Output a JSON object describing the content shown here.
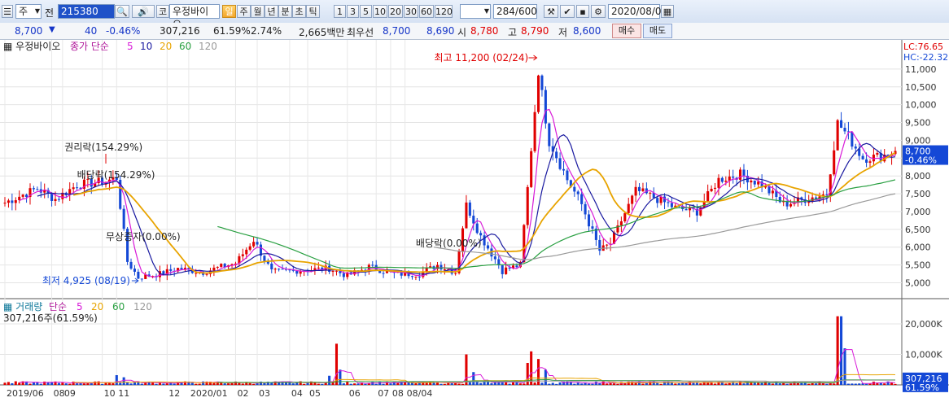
{
  "toolbar": {
    "market_options": [
      "주",
      "전"
    ],
    "stock_code": "215380",
    "stock_name": "우정바이오",
    "period_labels": [
      "주",
      "월",
      "년",
      "분",
      "초",
      "틱"
    ],
    "active_period_label": "일",
    "minute_intervals": [
      "1",
      "3",
      "5",
      "10",
      "20",
      "30",
      "60",
      "120"
    ],
    "data_count": "284",
    "data_max": "/600",
    "date": "2020/08/04",
    "code_prefix": "코"
  },
  "quote": {
    "price": "8,700",
    "change": "40",
    "change_pct": "-0.46%",
    "volume": "307,216",
    "volume_pct": "61.59%",
    "turnover": "2.74%",
    "amount": "2,665백만",
    "bid_label": "최우선",
    "bid_ask": "8,700",
    "bid": "8,690",
    "open_label": "시",
    "open": "8,780",
    "high_label": "고",
    "high": "8,790",
    "low_label": "저",
    "low": "8,600",
    "buy_label": "매수",
    "sell_label": "매도"
  },
  "price_panel": {
    "stock_label": "우정바이오",
    "legend_prefix": "종가 단순",
    "ma_periods": [
      "5",
      "10",
      "20",
      "60",
      "120"
    ],
    "ma_colors": [
      "#d81bd8",
      "#1a1aa0",
      "#e8a400",
      "#2aa042",
      "#9a9a9a"
    ],
    "lc_label": "LC:76.65",
    "hc_label": "HC:-22.32",
    "last_price_label": "8,700",
    "last_change_label": "-0.46%",
    "annotations": {
      "high": "최고 11,200 (02/24)",
      "low": "최저 4,925 (08/19)",
      "rights1": "권리락(154.29%)",
      "rights2": "배당락(154.29%)",
      "free_issue": "무상증자(0.00%)",
      "dividend": "배당락(0.00%)"
    }
  },
  "volume_panel": {
    "label": "거래량",
    "legend_prefix": "단순",
    "ma_periods": [
      "5",
      "20",
      "60",
      "120"
    ],
    "summary": "307,216주(61.59%)",
    "last_value_label": "307,216",
    "last_pct_label": "61.59%"
  },
  "chart_data": {
    "type": "candlestick",
    "price_axis": {
      "ylim": [
        4600,
        11500
      ],
      "ticks": [
        5000,
        5500,
        6000,
        6500,
        7000,
        7500,
        8000,
        8500,
        9000,
        9500,
        10000,
        10500,
        11000
      ],
      "tick_labels": [
        "5,000",
        "5,500",
        "6,000",
        "6,500",
        "7,000",
        "7,500",
        "8,000",
        "8,500",
        "9,000",
        "9,500",
        "10,000",
        "10,500",
        "11,000"
      ]
    },
    "volume_axis": {
      "ylim": [
        0,
        24000
      ],
      "ticks": [
        10000,
        20000
      ],
      "tick_labels": [
        "10,000K",
        "20,000K"
      ],
      "unit": "K"
    },
    "x_tick_labels": [
      "2019/06",
      "08",
      "09",
      "10",
      "11",
      "12",
      "2020/01",
      "02",
      "03",
      "04",
      "05",
      "06",
      "07",
      "08",
      "08/04"
    ],
    "x_tick_positions": [
      0,
      13,
      16,
      27,
      31,
      45,
      51,
      64,
      70,
      79,
      84,
      95,
      103,
      107,
      111
    ],
    "close_waypoints": [
      {
        "i": 0,
        "v": 7250
      },
      {
        "i": 9,
        "v": 7650
      },
      {
        "i": 14,
        "v": 7350
      },
      {
        "i": 20,
        "v": 7750
      },
      {
        "i": 28,
        "v": 7850
      },
      {
        "i": 31,
        "v": 7950
      },
      {
        "i": 34,
        "v": 5600
      },
      {
        "i": 37,
        "v": 5150
      },
      {
        "i": 43,
        "v": 5250
      },
      {
        "i": 48,
        "v": 5400
      },
      {
        "i": 55,
        "v": 5300
      },
      {
        "i": 60,
        "v": 5450
      },
      {
        "i": 64,
        "v": 5550
      },
      {
        "i": 69,
        "v": 6200
      },
      {
        "i": 74,
        "v": 5300
      },
      {
        "i": 82,
        "v": 5350
      },
      {
        "i": 90,
        "v": 5400
      },
      {
        "i": 95,
        "v": 5200
      },
      {
        "i": 101,
        "v": 5450
      },
      {
        "i": 108,
        "v": 5250
      },
      {
        "i": 115,
        "v": 5250
      },
      {
        "i": 120,
        "v": 5500
      },
      {
        "i": 125,
        "v": 5300
      },
      {
        "i": 128,
        "v": 7200
      },
      {
        "i": 132,
        "v": 6300
      },
      {
        "i": 138,
        "v": 5350
      },
      {
        "i": 143,
        "v": 5500
      },
      {
        "i": 148,
        "v": 10900
      },
      {
        "i": 151,
        "v": 9000
      },
      {
        "i": 156,
        "v": 7900
      },
      {
        "i": 160,
        "v": 7200
      },
      {
        "i": 165,
        "v": 5900
      },
      {
        "i": 168,
        "v": 6100
      },
      {
        "i": 175,
        "v": 7600
      },
      {
        "i": 180,
        "v": 7400
      },
      {
        "i": 186,
        "v": 7100
      },
      {
        "i": 192,
        "v": 7000
      },
      {
        "i": 198,
        "v": 7900
      },
      {
        "i": 204,
        "v": 8050
      },
      {
        "i": 210,
        "v": 7750
      },
      {
        "i": 216,
        "v": 7200
      },
      {
        "i": 222,
        "v": 7350
      },
      {
        "i": 228,
        "v": 7500
      },
      {
        "i": 231,
        "v": 9500
      },
      {
        "i": 234,
        "v": 9100
      },
      {
        "i": 238,
        "v": 8500
      },
      {
        "i": 243,
        "v": 8550
      },
      {
        "i": 247,
        "v": 8700
      }
    ],
    "volume_spikes": [
      {
        "i": 31,
        "v": 3200
      },
      {
        "i": 33,
        "v": 2500
      },
      {
        "i": 90,
        "v": 3000
      },
      {
        "i": 92,
        "v": 13500
      },
      {
        "i": 93,
        "v": 5000
      },
      {
        "i": 128,
        "v": 10000
      },
      {
        "i": 130,
        "v": 4200
      },
      {
        "i": 145,
        "v": 7200
      },
      {
        "i": 146,
        "v": 11000
      },
      {
        "i": 148,
        "v": 8500
      },
      {
        "i": 150,
        "v": 5000
      },
      {
        "i": 231,
        "v": 22500
      },
      {
        "i": 232,
        "v": 22500
      },
      {
        "i": 233,
        "v": 12000
      }
    ],
    "last_close": 8700,
    "last_volume_k": 307
  }
}
